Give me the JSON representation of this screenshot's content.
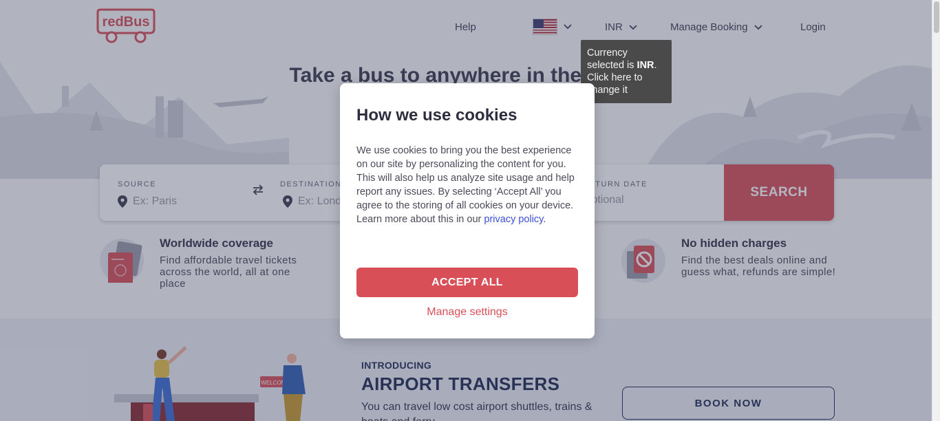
{
  "header": {
    "logo_text": "redBus",
    "help": "Help",
    "currency": "INR",
    "manage_booking": "Manage Booking",
    "login": "Login",
    "flag_icon": "us-flag-icon"
  },
  "currency_tooltip": {
    "line1": "Currency",
    "line2_prefix": "selected is ",
    "line2_bold": "INR",
    "line2_suffix": ".",
    "line3": "Click here to",
    "line4": "change it"
  },
  "hero": {
    "title": "Take a bus to anywhere in the world"
  },
  "search": {
    "source_label": "SOURCE",
    "source_placeholder": "Ex: Paris",
    "destination_label": "DESTINATION",
    "destination_placeholder": "Ex: London",
    "return_label": "RETURN DATE",
    "return_placeholder": "Optional",
    "button": "SEARCH"
  },
  "features": [
    {
      "title": "Worldwide coverage",
      "desc": "Find affordable travel tickets across the world, all at one place"
    },
    {
      "title": "No hidden charges",
      "desc": "Find the best deals online and guess what, refunds are simple!"
    }
  ],
  "airport": {
    "intro": "INTRODUCING",
    "title": "AIRPORT TRANSFERS",
    "desc": "You can travel low cost airport shuttles, trains & boats and ferry",
    "book_button": "BOOK NOW",
    "sign_text": "WELCOME"
  },
  "cookie_modal": {
    "title": "How we use cookies",
    "body": "We use cookies to bring you the best experience on our site by personalizing the content for you. This will also help us analyze site usage and help report any issues. By selecting ‘Accept All’ you agree to the storing of all cookies on your device. Learn more about this in our ",
    "link": "privacy policy",
    "body_end": ".",
    "accept": "ACCEPT ALL",
    "manage": "Manage settings"
  },
  "colors": {
    "brand_red": "#d84f57",
    "navy": "#1d2a52",
    "link_blue": "#3b4fd6"
  }
}
